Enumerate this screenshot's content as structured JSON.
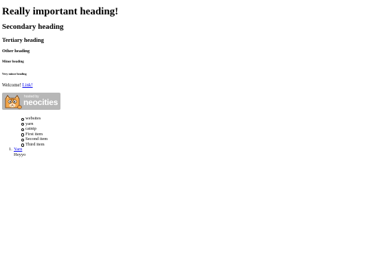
{
  "headings": {
    "h1": "Really important heading!",
    "h2": "Secondary heading",
    "h3": "Tertiary heading",
    "h4": "Other heading",
    "h5": "Minor heading",
    "h6": "Very minor heading"
  },
  "welcome": {
    "text": "Welcome!",
    "link": "Link!"
  },
  "badge": {
    "small": "hosted by",
    "big": "neocities",
    "icon": "neocities-cat-icon"
  },
  "nested_list": [
    "websites",
    "yarn",
    "catnip",
    "First item",
    "Second item",
    "Third item"
  ],
  "ordered_list": {
    "number": "1.",
    "link": "Yarn",
    "text": "Heyyo"
  }
}
